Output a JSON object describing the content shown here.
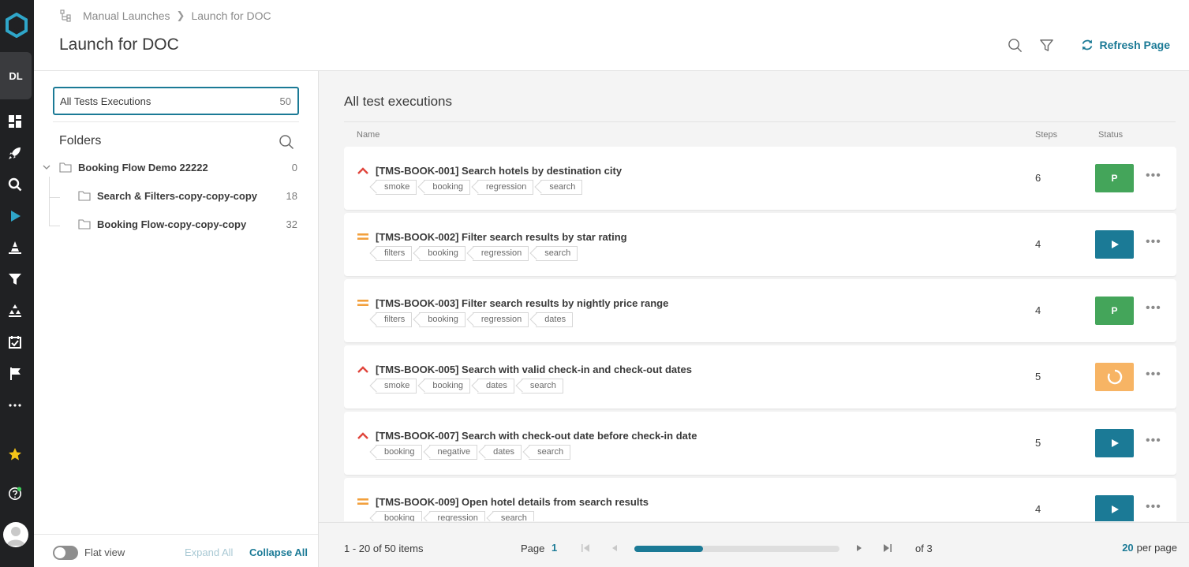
{
  "breadcrumb": {
    "parent": "Manual Launches",
    "current": "Launch for DOC"
  },
  "page_title": "Launch for DOC",
  "header": {
    "refresh_label": "Refresh Page"
  },
  "nav": {
    "project_initials": "DL"
  },
  "folders_panel": {
    "all_tests": {
      "label": "All Tests Executions",
      "count": "50"
    },
    "title": "Folders",
    "tree": [
      {
        "label": "Booking Flow Demo 22222",
        "count": "0"
      },
      {
        "label": "Search & Filters-copy-copy-copy",
        "count": "18"
      },
      {
        "label": "Booking Flow-copy-copy-copy",
        "count": "32"
      }
    ],
    "footer": {
      "flat_view": "Flat view",
      "expand_all": "Expand All",
      "collapse_all": "Collapse All"
    }
  },
  "main": {
    "title": "All test executions",
    "columns": {
      "name": "Name",
      "steps": "Steps",
      "status": "Status"
    },
    "rows": [
      {
        "priority": "high",
        "title": "[TMS-BOOK-001] Search hotels by destination city",
        "tags": [
          "smoke",
          "booking",
          "regression",
          "search"
        ],
        "steps": "6",
        "status": "passed",
        "status_label": "P"
      },
      {
        "priority": "medium",
        "title": "[TMS-BOOK-002] Filter search results by star rating",
        "tags": [
          "filters",
          "booking",
          "regression",
          "search"
        ],
        "steps": "4",
        "status": "run",
        "status_label": ""
      },
      {
        "priority": "medium",
        "title": "[TMS-BOOK-003] Filter search results by nightly price range",
        "tags": [
          "filters",
          "booking",
          "regression",
          "dates"
        ],
        "steps": "4",
        "status": "passed",
        "status_label": "P"
      },
      {
        "priority": "high",
        "title": "[TMS-BOOK-005] Search with valid check-in and check-out dates",
        "tags": [
          "smoke",
          "booking",
          "dates",
          "search"
        ],
        "steps": "5",
        "status": "in-progress",
        "status_label": ""
      },
      {
        "priority": "high",
        "title": "[TMS-BOOK-007] Search with check-out date before check-in date",
        "tags": [
          "booking",
          "negative",
          "dates",
          "search"
        ],
        "steps": "5",
        "status": "run",
        "status_label": ""
      },
      {
        "priority": "medium",
        "title": "[TMS-BOOK-009] Open hotel details from search results",
        "tags": [
          "booking",
          "regression",
          "search"
        ],
        "steps": "4",
        "status": "run",
        "status_label": ""
      }
    ]
  },
  "pagination": {
    "items_text": "1 - 20 of 50 items",
    "page_label": "Page",
    "current_page": "1",
    "of_text": "of 3",
    "per_page_value": "20",
    "per_page_label": "per page",
    "progress": 0.333
  },
  "colors": {
    "accent": "#1b7a96",
    "passed": "#44a55a",
    "in_progress": "#f7b464",
    "priority_high": "#e0453c",
    "priority_medium": "#f2a03d",
    "nav_bg": "#202123"
  }
}
